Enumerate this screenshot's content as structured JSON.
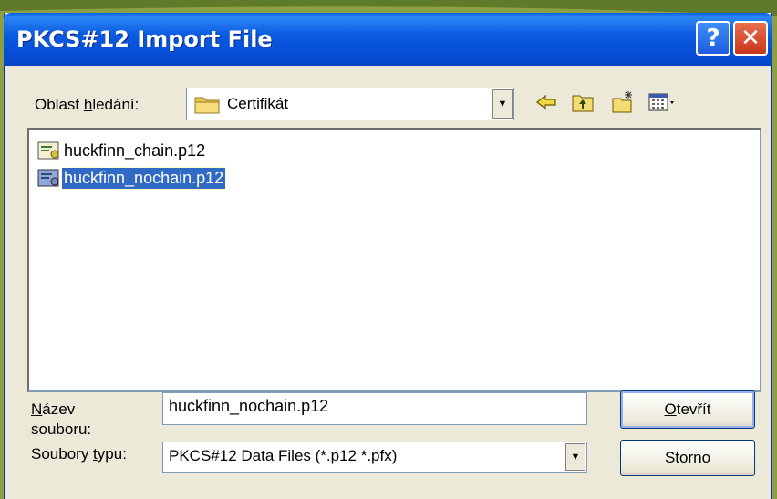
{
  "window": {
    "title": "PKCS#12 Import File"
  },
  "lookin": {
    "label_pre": "Oblast ",
    "label_ul": "h",
    "label_post": "ledání:",
    "value": "Certifikát"
  },
  "files": [
    {
      "name": "huckfinn_chain.p12",
      "selected": false
    },
    {
      "name": "huckfinn_nochain.p12",
      "selected": true
    }
  ],
  "filename": {
    "label_line1_ul": "N",
    "label_line1_rest": "ázev",
    "label_line2": "souboru:",
    "value": "huckfinn_nochain.p12"
  },
  "filetype": {
    "label_pre": "Soubory ",
    "label_ul": "t",
    "label_post": "ypu:",
    "value": "PKCS#12 Data Files (*.p12 *.pfx)"
  },
  "buttons": {
    "open_ul": "O",
    "open_rest": "tevřít",
    "cancel": "Storno"
  },
  "colors": {
    "titlebar": "#0650d8",
    "selection": "#316ac5",
    "dialog_bg": "#ece9d8"
  }
}
